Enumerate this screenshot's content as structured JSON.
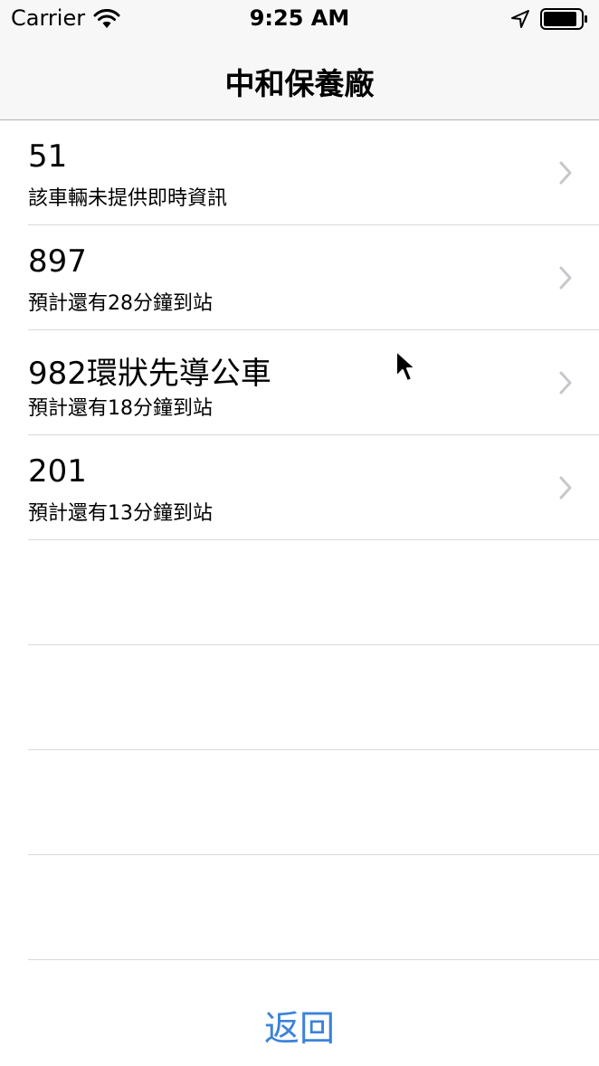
{
  "status_bar": {
    "carrier": "Carrier",
    "time": "9:25 AM",
    "icons": [
      "wifi-icon",
      "location-icon",
      "battery-icon"
    ]
  },
  "nav": {
    "title": "中和保養廠"
  },
  "routes": [
    {
      "title": "51",
      "subtitle": "該車輛未提供即時資訊"
    },
    {
      "title": "897",
      "subtitle": "預計還有28分鐘到站"
    },
    {
      "title": "982環狀先導公車",
      "subtitle": "預計還有18分鐘到站"
    },
    {
      "title": "201",
      "subtitle": "預計還有13分鐘到站"
    }
  ],
  "footer": {
    "back_label": "返回"
  },
  "colors": {
    "accent": "#3b83db",
    "separator": "#d9d9d9",
    "chevron": "#c7c7cc",
    "bar_background": "#f7f7f7"
  }
}
